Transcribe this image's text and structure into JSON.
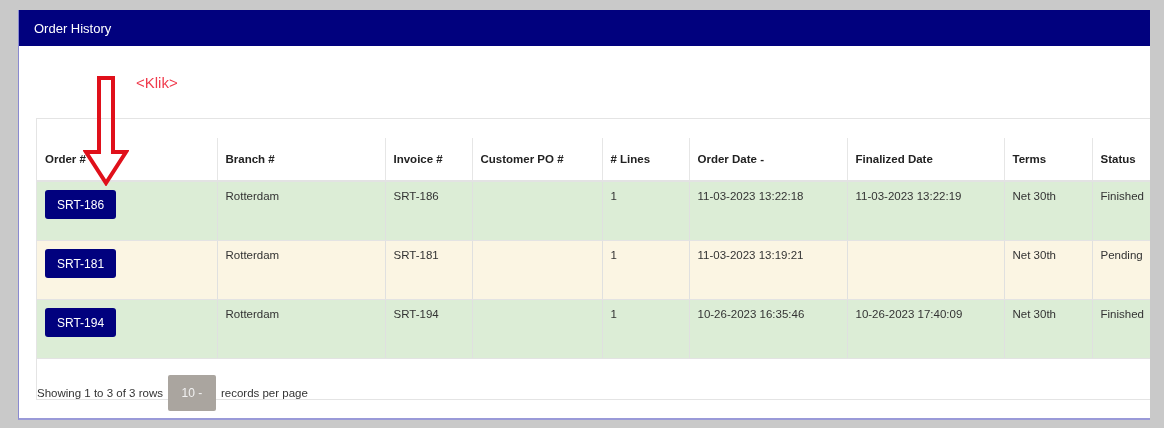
{
  "panel": {
    "title": "Order History"
  },
  "annotation": {
    "label": "<Klik>"
  },
  "table": {
    "columns": [
      "Order #",
      "Branch #",
      "Invoice #",
      "Customer PO #",
      "# Lines",
      "Order Date -",
      "Finalized Date",
      "Terms",
      "Status"
    ],
    "rows": [
      {
        "color": "#dcedd6",
        "order": "SRT-186",
        "branch": "Rotterdam",
        "invoice": "SRT-186",
        "lines": "1",
        "order_date": "11-03-2023 13:22:18",
        "finalized_date": "11-03-2023 13:22:19",
        "terms": "Net 30th",
        "status": "Finished"
      },
      {
        "color": "#fbf5e3",
        "order": "SRT-181",
        "branch": "Rotterdam",
        "invoice": "SRT-181",
        "lines": "1",
        "order_date": "11-03-2023 13:19:21",
        "terms": "Net 30th",
        "status": "Pending"
      },
      {
        "color": "#dcedd6",
        "order": "SRT-194",
        "branch": "Rotterdam",
        "invoice": "SRT-194",
        "lines": "1",
        "order_date": "10-26-2023 16:35:46",
        "finalized_date": "10-26-2023 17:40:09",
        "terms": "Net 30th",
        "status": "Finished"
      }
    ]
  },
  "footer": {
    "summary": "Showing 1 to 3 of 3 rows",
    "page_size": "10 -",
    "suffix": "records per page"
  }
}
